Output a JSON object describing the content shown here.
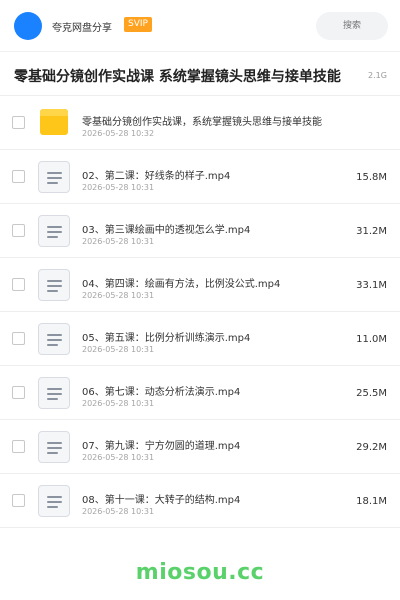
{
  "header": {
    "app_name": "夸克网盘分享",
    "badge": "SVIP",
    "search_placeholder": "搜索"
  },
  "share": {
    "title": "零基础分镜创作实战课 系统掌握镜头思维与接单技能",
    "total_size": "2.1G"
  },
  "files": [
    {
      "name": "零基础分镜创作实战课，系统掌握镜头思维与接单技能",
      "date": "2026-05-28 10:32",
      "size": "",
      "type": "folder",
      "icon": "folder-icon"
    },
    {
      "name": "02、第二课：好线条的样子.mp4",
      "date": "2026-05-28 10:31",
      "size": "15.8M",
      "type": "file",
      "icon": "video-file-icon"
    },
    {
      "name": "03、第三课绘画中的透视怎么学.mp4",
      "date": "2026-05-28 10:31",
      "size": "31.2M",
      "type": "file",
      "icon": "video-file-icon"
    },
    {
      "name": "04、第四课：绘画有方法，比例没公式.mp4",
      "date": "2026-05-28 10:31",
      "size": "33.1M",
      "type": "file",
      "icon": "video-file-icon"
    },
    {
      "name": "05、第五课：比例分析训练演示.mp4",
      "date": "2026-05-28 10:31",
      "size": "11.0M",
      "type": "file",
      "icon": "video-file-icon"
    },
    {
      "name": "06、第七课：动态分析法演示.mp4",
      "date": "2026-05-28 10:31",
      "size": "25.5M",
      "type": "file",
      "icon": "video-file-icon"
    },
    {
      "name": "07、第九课：宁方勿圆的道理.mp4",
      "date": "2026-05-28 10:31",
      "size": "29.2M",
      "type": "file",
      "icon": "video-file-icon"
    },
    {
      "name": "08、第十一课：大转子的结构.mp4",
      "date": "2026-05-28 10:31",
      "size": "18.1M",
      "type": "file",
      "icon": "video-file-icon"
    }
  ],
  "footer": {
    "watermark": "miosou.cc"
  },
  "colors": {
    "avatar": "#1a82ff",
    "badge": "#ffa21f",
    "folder": "#ffc61a",
    "watermark": "#5bd16b"
  }
}
